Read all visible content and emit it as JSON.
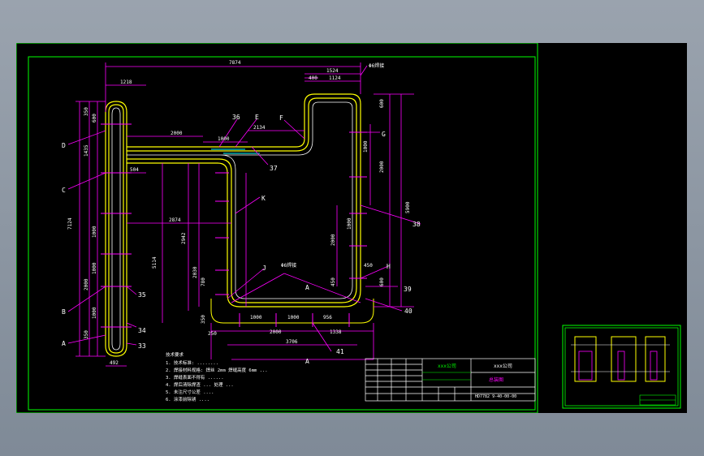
{
  "drawing": {
    "overall_width": "7874",
    "top_left_offset": "1218",
    "top_right_width": "1524",
    "top_right_inner": "1124",
    "top_right_small": "400",
    "left_height": "7124",
    "mid_span": "2874",
    "mid_height": "5114",
    "bottom_width": "3706",
    "bottom_left": "2000",
    "bottom_right": "1338",
    "bottom_seg1": "1000",
    "bottom_seg2": "1000",
    "bottom_seg3": "956",
    "left_bottom_width": "492",
    "right_height": "5900",
    "inner_2000_a": "2000",
    "inner_1000_a": "1000",
    "inner_2134": "2134",
    "inner_504": "504",
    "inner_2942": "2942",
    "inner_2030": "2030",
    "inner_780": "780",
    "inner_350": "350",
    "inner_250": "250",
    "inner_450": "450",
    "left_dims": [
      "350",
      "600",
      "1435",
      "1000",
      "1000",
      "2000",
      "1000",
      "350"
    ],
    "right_dims": [
      "600",
      "2000",
      "1000",
      "2000",
      "1000",
      "450",
      "450",
      "600"
    ],
    "labels": {
      "A": "A",
      "B": "B",
      "C": "C",
      "D": "D",
      "E": "E",
      "F": "F",
      "G": "G",
      "H": "H",
      "J": "J",
      "K": "K",
      "n33": "33",
      "n34": "34",
      "n35": "35",
      "n36": "36",
      "n37": "37",
      "n38": "38",
      "n39": "39",
      "n40": "40",
      "n41": "41",
      "weld_top": "Φ6焊接",
      "weld_mid": "Φ6焊接"
    }
  },
  "notes": {
    "heading": "技术要求",
    "lines": [
      "1. 技术标准: ........",
      "2. 焊接材料规格: 焊丝 2mm 焊缝高度 6mm ...",
      "3. 焊缝表面不得有 ......  ",
      "4. 焊后清除焊渣 ... 处理 ...",
      "5. 未注尺寸公差 ....",
      "6. 涂漆前除锈 ...."
    ]
  },
  "title_block": {
    "company": "xxx公司",
    "drawing_name": "总装图",
    "drawing_number": "HD7782 9-40-00-00"
  },
  "colors": {
    "frame": "#00ff00",
    "dimension": "#ff00ff",
    "outline": "#ffff00",
    "text": "#ffffff",
    "leader": "#ff00ff",
    "cyan": "#00ffff"
  }
}
